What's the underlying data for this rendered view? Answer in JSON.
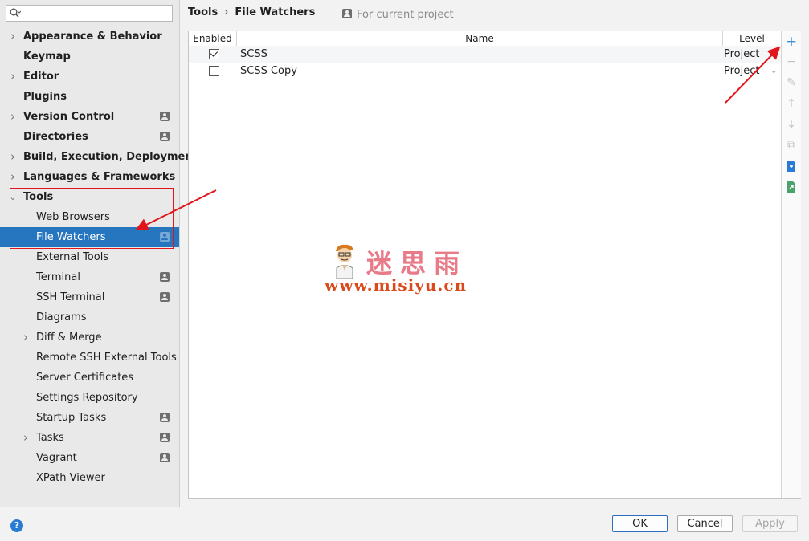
{
  "search": {
    "placeholder": ""
  },
  "sidebar": {
    "items": [
      {
        "label": "Appearance & Behavior",
        "level": 0,
        "bold": true,
        "expander": "collapsed",
        "project_icon": false
      },
      {
        "label": "Keymap",
        "level": 0,
        "bold": true,
        "expander": "none",
        "project_icon": false
      },
      {
        "label": "Editor",
        "level": 0,
        "bold": true,
        "expander": "collapsed",
        "project_icon": false
      },
      {
        "label": "Plugins",
        "level": 0,
        "bold": true,
        "expander": "none",
        "project_icon": false
      },
      {
        "label": "Version Control",
        "level": 0,
        "bold": true,
        "expander": "collapsed",
        "project_icon": true
      },
      {
        "label": "Directories",
        "level": 0,
        "bold": true,
        "expander": "none",
        "project_icon": true
      },
      {
        "label": "Build, Execution, Deployment",
        "level": 0,
        "bold": true,
        "expander": "collapsed",
        "project_icon": false
      },
      {
        "label": "Languages & Frameworks",
        "level": 0,
        "bold": true,
        "expander": "collapsed",
        "project_icon": false
      },
      {
        "label": "Tools",
        "level": 0,
        "bold": true,
        "expander": "expanded",
        "project_icon": false
      },
      {
        "label": "Web Browsers",
        "level": 1,
        "bold": false,
        "expander": "none",
        "project_icon": false
      },
      {
        "label": "File Watchers",
        "level": 1,
        "bold": false,
        "expander": "none",
        "project_icon": true,
        "selected": true
      },
      {
        "label": "External Tools",
        "level": 1,
        "bold": false,
        "expander": "none",
        "project_icon": false
      },
      {
        "label": "Terminal",
        "level": 1,
        "bold": false,
        "expander": "none",
        "project_icon": true
      },
      {
        "label": "SSH Terminal",
        "level": 1,
        "bold": false,
        "expander": "none",
        "project_icon": true
      },
      {
        "label": "Diagrams",
        "level": 1,
        "bold": false,
        "expander": "none",
        "project_icon": false
      },
      {
        "label": "Diff & Merge",
        "level": 1,
        "bold": false,
        "expander": "collapsed",
        "project_icon": false
      },
      {
        "label": "Remote SSH External Tools",
        "level": 1,
        "bold": false,
        "expander": "none",
        "project_icon": false
      },
      {
        "label": "Server Certificates",
        "level": 1,
        "bold": false,
        "expander": "none",
        "project_icon": false
      },
      {
        "label": "Settings Repository",
        "level": 1,
        "bold": false,
        "expander": "none",
        "project_icon": false
      },
      {
        "label": "Startup Tasks",
        "level": 1,
        "bold": false,
        "expander": "none",
        "project_icon": true
      },
      {
        "label": "Tasks",
        "level": 1,
        "bold": false,
        "expander": "collapsed",
        "project_icon": true
      },
      {
        "label": "Vagrant",
        "level": 1,
        "bold": false,
        "expander": "none",
        "project_icon": true
      },
      {
        "label": "XPath Viewer",
        "level": 1,
        "bold": false,
        "expander": "none",
        "project_icon": false
      }
    ]
  },
  "breadcrumb": {
    "parent": "Tools",
    "separator": "›",
    "current": "File Watchers"
  },
  "scope_note": "For current project",
  "table": {
    "headers": {
      "enabled": "Enabled",
      "name": "Name",
      "level": "Level"
    },
    "rows": [
      {
        "enabled": true,
        "name": "SCSS",
        "level": "Project"
      },
      {
        "enabled": false,
        "name": "SCSS Copy",
        "level": "Project"
      }
    ]
  },
  "toolbar": {
    "add": "+",
    "remove": "−",
    "edit": "✎",
    "move_up": "↑",
    "move_down": "↓",
    "copy": "⧉",
    "icons": [
      "add-icon",
      "remove-icon",
      "edit-icon",
      "move-up-icon",
      "move-down-icon",
      "copy-icon",
      "import-icon",
      "export-icon"
    ]
  },
  "watermark": {
    "title": "迷思雨",
    "url": "www.misiyu.cn"
  },
  "buttons": {
    "ok": "OK",
    "cancel": "Cancel",
    "apply": "Apply"
  },
  "help_icon": "?",
  "colors": {
    "selection": "#2675bf",
    "accent": "#3f8fd6",
    "annotation": "#e0161b"
  }
}
